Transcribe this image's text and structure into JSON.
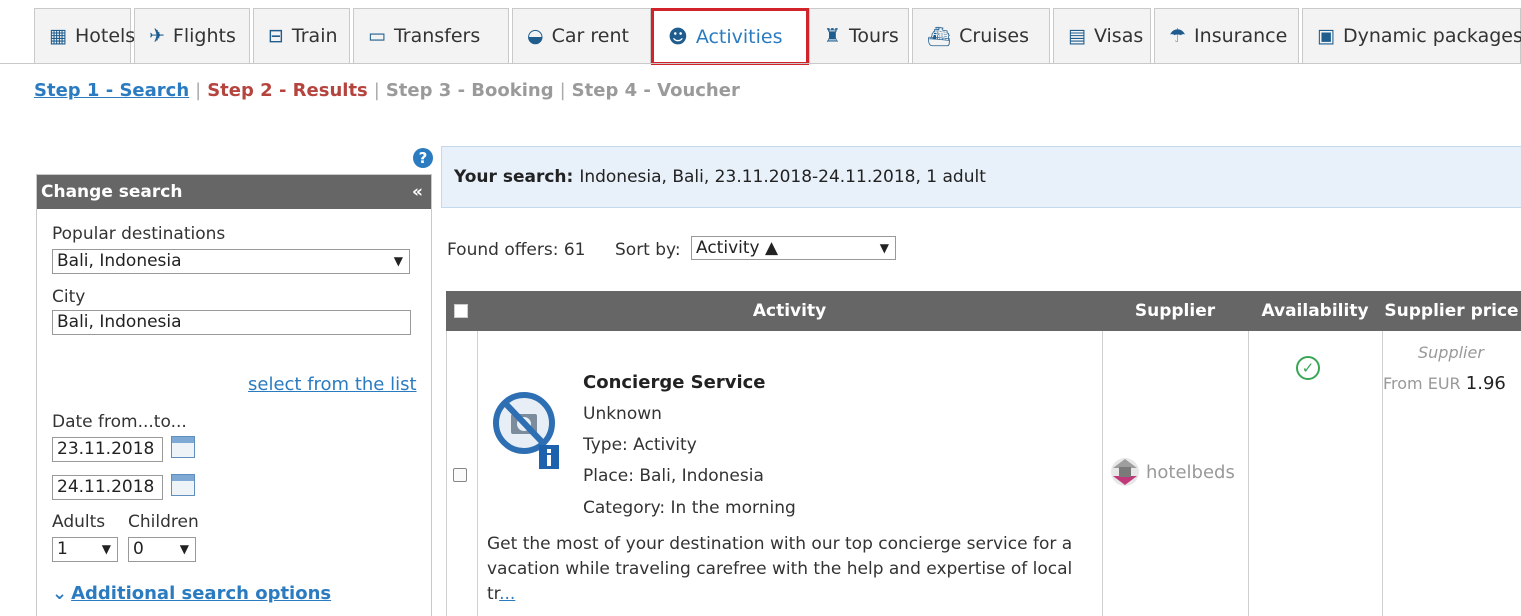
{
  "tabs": [
    {
      "label": "Hotels",
      "icon": "hotel-icon",
      "glyph": "▦"
    },
    {
      "label": "Flights",
      "icon": "plane-icon",
      "glyph": "✈"
    },
    {
      "label": "Train",
      "icon": "train-icon",
      "glyph": "🚆"
    },
    {
      "label": "Transfers",
      "icon": "bus-icon",
      "glyph": "🚌"
    },
    {
      "label": "Car rent",
      "icon": "car-icon",
      "glyph": "🚗"
    },
    {
      "label": "Activities",
      "icon": "theater-masks-icon",
      "glyph": "🎭"
    },
    {
      "label": "Tours",
      "icon": "tour-icon",
      "glyph": "🎒"
    },
    {
      "label": "Cruises",
      "icon": "ship-icon",
      "glyph": "🚢"
    },
    {
      "label": "Visas",
      "icon": "passport-icon",
      "glyph": "🛂"
    },
    {
      "label": "Insurance",
      "icon": "umbrella-icon",
      "glyph": "☂"
    },
    {
      "label": "Dynamic packages",
      "icon": "package-icon",
      "glyph": "📦"
    }
  ],
  "active_tab": "Activities",
  "steps": {
    "s1": "Step 1 - Search",
    "sep": "|",
    "s2": "Step 2 - Results",
    "s3": "Step 3 - Booking",
    "s4": "Step 4 - Voucher"
  },
  "sidebar": {
    "help": "?",
    "title": "Change search",
    "collapse": "«",
    "popular_label": "Popular destinations",
    "popular_value": "Bali, Indonesia",
    "city_label": "City",
    "city_value": "Bali, Indonesia",
    "select_list": "select from the list",
    "date_label": "Date from...to...",
    "date_from": "23.11.2018",
    "date_to": "24.11.2018",
    "adults_label": "Adults",
    "children_label": "Children",
    "adults_value": "1",
    "children_value": "0",
    "additional": "Additional search options"
  },
  "search": {
    "label": "Your search:",
    "value": "Indonesia, Bali, 23.11.2018-24.11.2018, 1 adult"
  },
  "results": {
    "found": "Found offers: 61",
    "sort_label": "Sort by:",
    "sort_value": "Activity ▲"
  },
  "table": {
    "headers": {
      "activity": "Activity",
      "supplier": "Supplier",
      "availability": "Availability",
      "price": "Supplier price"
    },
    "row": {
      "title": "Concierge Service",
      "line1": "Unknown",
      "line2": "Type: Activity",
      "line3": "Place: Bali, Indonesia",
      "line4": "Category: In the morning",
      "description": "Get the most of your destination with our top concierge service for a vacation while traveling carefree with the help and expertise of local",
      "desc_tail": "tr",
      "more": "...",
      "supplier": "hotelbeds",
      "price_supplier": "Supplier",
      "price_from": "From EUR",
      "price_value": "1.96"
    }
  },
  "colors": {
    "accent": "#2b7bc0",
    "active_border": "#d0232a",
    "header_bg": "#666666",
    "step2": "#b5443f"
  }
}
